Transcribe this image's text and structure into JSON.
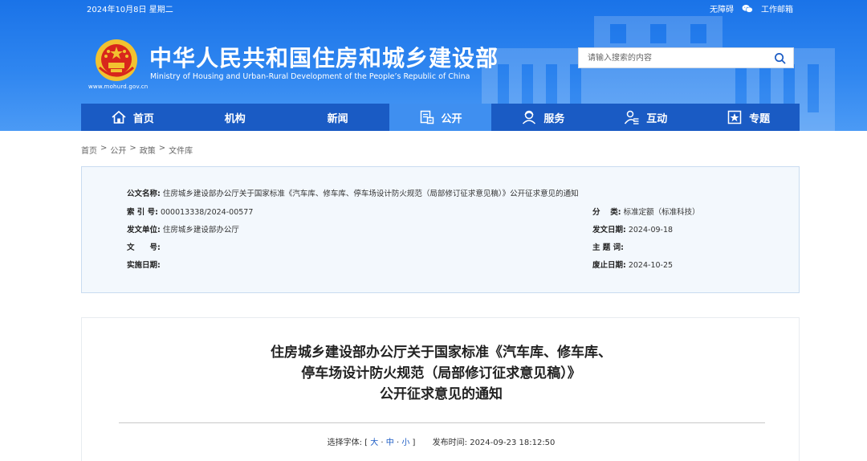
{
  "topbar": {
    "date": "2024年10月8日 星期二",
    "accessibility": "无障碍",
    "wechat_icon": "wechat-icon",
    "work_mail": "工作邮箱"
  },
  "site": {
    "url": "www.mohurd.gov.cn",
    "title": "中华人民共和国住房和城乡建设部",
    "subtitle": "Ministry of Housing and Urban-Rural Development of the People’s Republic of China"
  },
  "search": {
    "placeholder": "请输入搜索的内容",
    "value": ""
  },
  "nav": {
    "items": [
      {
        "label": "首页",
        "icon": "home-icon"
      },
      {
        "label": "机构",
        "icon": ""
      },
      {
        "label": "新闻",
        "icon": ""
      },
      {
        "label": "公开",
        "icon": "document-icon"
      },
      {
        "label": "服务",
        "icon": "service-icon"
      },
      {
        "label": "互动",
        "icon": "interaction-icon"
      },
      {
        "label": "专题",
        "icon": "topic-icon"
      }
    ],
    "active_index": 3
  },
  "breadcrumb": [
    "首页",
    "公开",
    "政策",
    "文件库"
  ],
  "info": {
    "doc_name_label": "公文名称:",
    "doc_name": "住房城乡建设部办公厅关于国家标准《汽车库、修车库、停车场设计防火规范（局部修订征求意见稿）》公开征求意见的通知",
    "index_label": "索 引 号:",
    "index": "000013338/2024-00577",
    "category_label": "分　 类:",
    "category": "标准定额（标准科技）",
    "issuer_label": "发文单位:",
    "issuer": "住房城乡建设部办公厅",
    "issue_date_label": "发文日期:",
    "issue_date": "2024-09-18",
    "doc_no_label": "文　　号:",
    "doc_no": "",
    "subject_label": "主 题 词:",
    "subject": "",
    "effective_label": "实施日期:",
    "effective": "",
    "expire_label": "废止日期:",
    "expire": "2024-10-25"
  },
  "article": {
    "title_line1": "住房城乡建设部办公厅关于国家标准《汽车库、修车库、",
    "title_line2": "停车场设计防火规范（局部修订征求意见稿）》",
    "title_line3": "公开征求意见的通知",
    "font_select_label": "选择字体:",
    "font_large": "大",
    "font_medium": "中",
    "font_small": "小",
    "publish_label": "发布时间:",
    "publish_time": "2024-09-23 18:12:50"
  },
  "colors": {
    "header_blue": "#1a73e8",
    "nav_blue": "#1a5bc4",
    "nav_active": "#3f8ff0",
    "info_bg": "#f3f8fd"
  }
}
